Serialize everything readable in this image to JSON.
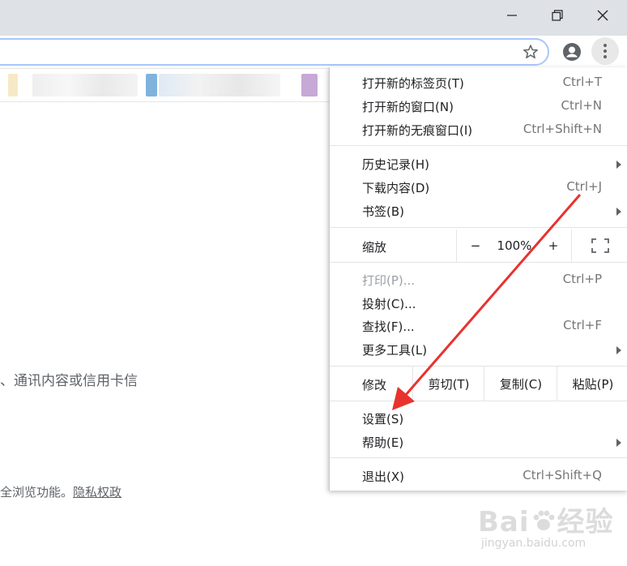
{
  "window": {
    "minimize_icon": "minimize-icon",
    "restore_icon": "restore-icon",
    "close_icon": "close-icon"
  },
  "toolbar": {
    "star_icon": "star-icon",
    "profile_icon": "profile-icon",
    "menu_icon": "kebab-menu-icon"
  },
  "page": {
    "line1": "、通讯内容或信用卡信",
    "line2": "全浏览功能。",
    "privacy_link": "隐私权政"
  },
  "menu": {
    "new_tab": {
      "label": "打开新的标签页(T)",
      "shortcut": "Ctrl+T"
    },
    "new_window": {
      "label": "打开新的窗口(N)",
      "shortcut": "Ctrl+N"
    },
    "new_incognito": {
      "label": "打开新的无痕窗口(I)",
      "shortcut": "Ctrl+Shift+N"
    },
    "history": {
      "label": "历史记录(H)"
    },
    "downloads": {
      "label": "下载内容(D)",
      "shortcut": "Ctrl+J"
    },
    "bookmarks": {
      "label": "书签(B)"
    },
    "zoom": {
      "label": "缩放",
      "minus": "−",
      "value": "100%",
      "plus": "+"
    },
    "print": {
      "label": "打印(P)...",
      "shortcut": "Ctrl+P"
    },
    "cast": {
      "label": "投射(C)..."
    },
    "find": {
      "label": "查找(F)...",
      "shortcut": "Ctrl+F"
    },
    "more_tools": {
      "label": "更多工具(L)"
    },
    "edit": {
      "label": "修改",
      "cut": "剪切(T)",
      "copy": "复制(C)",
      "paste": "粘贴(P)"
    },
    "settings": {
      "label": "设置(S)"
    },
    "help": {
      "label": "帮助(E)"
    },
    "exit": {
      "label": "退出(X)",
      "shortcut": "Ctrl+Shift+Q"
    }
  },
  "annotation": {
    "arrow_color": "#e8322e"
  },
  "watermark": {
    "brand_a": "Bai",
    "brand_b": "经验",
    "url": "jingyan.baidu.com"
  }
}
